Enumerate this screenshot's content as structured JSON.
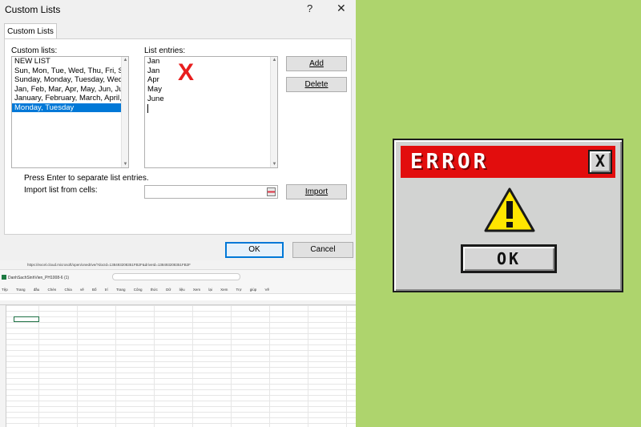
{
  "dialog": {
    "title": "Custom Lists",
    "help_icon": "?",
    "close_icon": "✕",
    "tab": "Custom Lists",
    "custom_lists_label": "Custom lists:",
    "custom_lists": [
      "NEW LIST",
      "Sun, Mon, Tue, Wed, Thu, Fri, Sat",
      "Sunday, Monday, Tuesday, Wednesday",
      "Jan, Feb, Mar, Apr, May, Jun, Jul, Aug",
      "January, February, March, April, May",
      "Monday, Tuesday"
    ],
    "selected_index": 5,
    "entries_label": "List entries:",
    "entries": [
      "Jan",
      "Jan",
      "Apr",
      "May",
      "June"
    ],
    "red_mark": "X",
    "add_button": "Add",
    "delete_button": "Delete",
    "hint": "Press Enter to separate list entries.",
    "import_label": "Import list from cells:",
    "import_button": "Import",
    "ok_button": "OK",
    "cancel_button": "Cancel"
  },
  "excel_bg": {
    "url": "https://excel.cloud.microsoft/open/onedrive/?docId=138493208351FB2F&driveId=138493208351FB2F",
    "file_name": "DanhSachSinhVien_PH1008-6 (1)",
    "menu": "Tệp Trang đầu Chèn Chia vẽ Bố trí Trang Công thức Dữ liệu Xem lại Xem Trợ giúp Vẽ"
  },
  "error_box": {
    "title": "ERROR",
    "close_label": "X",
    "ok_label": "OK",
    "colors": {
      "header": "#e20d0d",
      "warning": "#ffe600",
      "background": "#aed46d"
    }
  }
}
